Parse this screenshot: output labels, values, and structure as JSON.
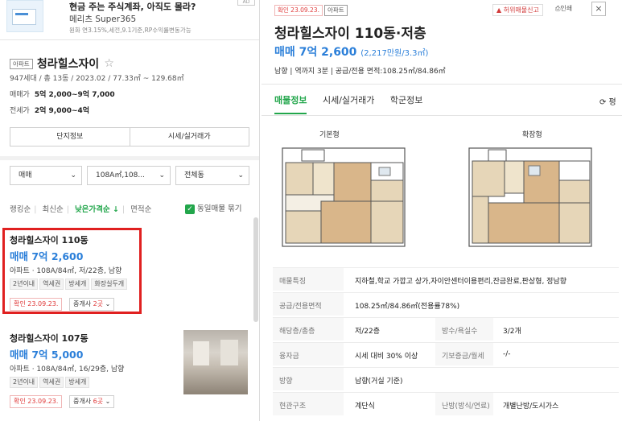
{
  "ad": {
    "title": "현금 주는 주식계좌, 아직도 몰라?",
    "brand": "메리츠 Super365",
    "desc": "원화 연3.15%,세전,9.1기준,RP수익률변동가능",
    "badge": "AD"
  },
  "complex": {
    "tag": "아파트",
    "name": "청라힐스자이",
    "star": "☆",
    "info": "947세대 / 총 13동 / 2023.02 / 77.33㎡ ~ 129.68㎡",
    "sale_label": "매매가",
    "sale_value": "5억 2,000~9억 7,000",
    "lease_label": "전세가",
    "lease_value": "2억 9,000~4억",
    "btn_info": "단지정보",
    "btn_price": "시세/실거래가"
  },
  "filters": {
    "type": "매매",
    "area": "108A㎡,108...",
    "dong": "전체동"
  },
  "sort": {
    "items": [
      "랭킹순",
      "최신순",
      "낮은가격순 ↓",
      "면적순"
    ],
    "same_listing": "동일매물 묶기"
  },
  "listings": [
    {
      "title": "청라힐스자이 110동",
      "price": "매매 7억 2,600",
      "detail": "아파트 · 108A/84㎡, 저/22층, 남향",
      "tags": [
        "2년이내",
        "역세권",
        "방세개",
        "화장실두개"
      ],
      "confirm": "확인 23.09.23.",
      "agent_prefix": "중개사 ",
      "agent_count": "2곳"
    },
    {
      "title": "청라힐스자이 107동",
      "price": "매매 7억 5,000",
      "detail": "아파트 · 108A/84㎡, 16/29층, 남향",
      "tags": [
        "2년이내",
        "역세권",
        "방세개"
      ],
      "confirm": "확인 23.09.23.",
      "agent_prefix": "중개사 ",
      "agent_count": "6곳"
    }
  ],
  "detail": {
    "confirm": "확인 23.09.23.",
    "tag": "아파트",
    "report": "허위매물신고",
    "print": "인쇄",
    "close": "×",
    "title": "청라힐스자이 110동·저층",
    "price": "매매 7억 2,600",
    "price_unit": "(2,217만원/3.3㎡)",
    "sub": "남향 | 역까지 3분 | 공급/전용 면적:108.25㎡/84.86㎡",
    "tabs": [
      "매물정보",
      "시세/실거래가",
      "학군정보"
    ],
    "side_tab": "⟳ 평",
    "plan_basic": "기본형",
    "plan_ext": "확장형"
  },
  "info_rows": [
    {
      "k": "매물특징",
      "v": "지하철,학교 가깝고 상가,자이안센터이용편리,잔금완료,판상형, 정남향"
    },
    {
      "k": "공급/전용면적",
      "v": "108.25㎡/84.86㎡(전용률78%)"
    },
    {
      "k": "해당층/총층",
      "v": "저/22층",
      "k2": "방수/욕실수",
      "v2": "3/2개"
    },
    {
      "k": "융자금",
      "v": "시세 대비 30% 이상",
      "k2": "기보증금/월세",
      "v2": "-/-"
    },
    {
      "k": "방향",
      "v": "남향(거실 기준)"
    },
    {
      "k": "현관구조",
      "v": "계단식",
      "k2": "난방(방식/연료)",
      "v2": "개별난방/도시가스"
    }
  ],
  "colors": {
    "accent_green": "#22a64b",
    "price_blue": "#2b7fd9",
    "alert_red": "#e03a3a"
  }
}
